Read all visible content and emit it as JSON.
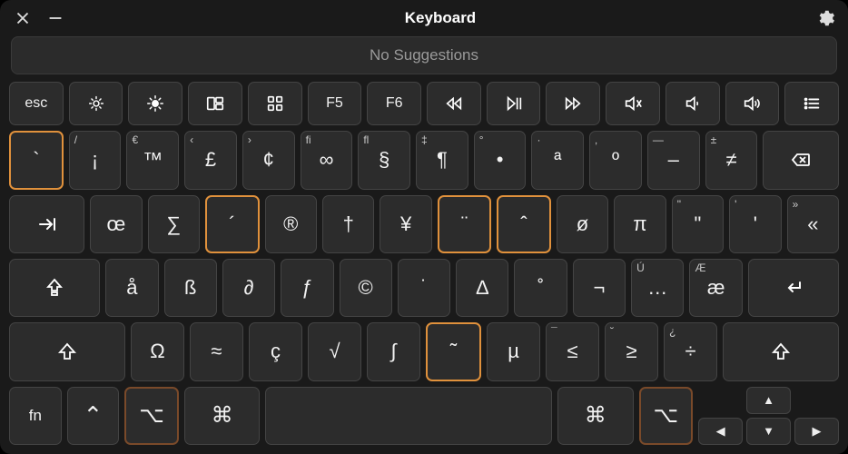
{
  "title": "Keyboard",
  "suggestions_text": "No Suggestions",
  "fn_row": {
    "esc": "esc",
    "f5": "F5",
    "f6": "F6"
  },
  "row1": {
    "k0": {
      "main": "`"
    },
    "k1": {
      "corner": "/",
      "main": "¡"
    },
    "k2": {
      "corner": "€",
      "main": "™"
    },
    "k3": {
      "corner": "‹",
      "main": "£"
    },
    "k4": {
      "corner": "›",
      "main": "¢"
    },
    "k5": {
      "corner": "fi",
      "main": "∞"
    },
    "k6": {
      "corner": "fl",
      "main": "§"
    },
    "k7": {
      "corner": "‡",
      "main": "¶"
    },
    "k8": {
      "corner": "°",
      "main": "•"
    },
    "k9": {
      "corner": "·",
      "main": "ª"
    },
    "k10": {
      "corner": "‚",
      "main": "º"
    },
    "k11": {
      "corner": "—",
      "main": "–"
    },
    "k12": {
      "corner": "±",
      "main": "≠"
    }
  },
  "row2": {
    "k0": {
      "main": "œ"
    },
    "k1": {
      "main": "∑"
    },
    "k2": {
      "main": "´"
    },
    "k3": {
      "main": "®"
    },
    "k4": {
      "main": "†"
    },
    "k5": {
      "main": "¥"
    },
    "k6": {
      "main": "¨"
    },
    "k7": {
      "main": "ˆ"
    },
    "k8": {
      "main": "ø"
    },
    "k9": {
      "main": "π"
    },
    "k10": {
      "corner": "\"",
      "main": "\""
    },
    "k11": {
      "corner": "'",
      "main": "'"
    },
    "k12": {
      "main": "«",
      "corner": "»"
    }
  },
  "row3": {
    "k0": {
      "main": "å"
    },
    "k1": {
      "main": "ß"
    },
    "k2": {
      "main": "∂"
    },
    "k3": {
      "main": "ƒ"
    },
    "k4": {
      "main": "©"
    },
    "k5": {
      "main": "˙"
    },
    "k6": {
      "main": "∆"
    },
    "k7": {
      "main": "˚"
    },
    "k8": {
      "main": "¬"
    },
    "k9": {
      "corner": "Ú",
      "main": "…"
    },
    "k10": {
      "corner": "Æ",
      "main": "æ"
    }
  },
  "row4": {
    "k0": {
      "main": "Ω"
    },
    "k1": {
      "main": "≈"
    },
    "k2": {
      "main": "ç"
    },
    "k3": {
      "main": "√"
    },
    "k4": {
      "main": "∫"
    },
    "k5": {
      "main": "˜"
    },
    "k6": {
      "main": "µ"
    },
    "k7": {
      "corner": "¯",
      "main": "≤"
    },
    "k8": {
      "corner": "˘",
      "main": "≥"
    },
    "k9": {
      "corner": "¿",
      "main": "÷"
    }
  },
  "row5": {
    "fn": "fn",
    "ctrl": "⌃",
    "opt": "⌥",
    "cmd": "⌘"
  }
}
